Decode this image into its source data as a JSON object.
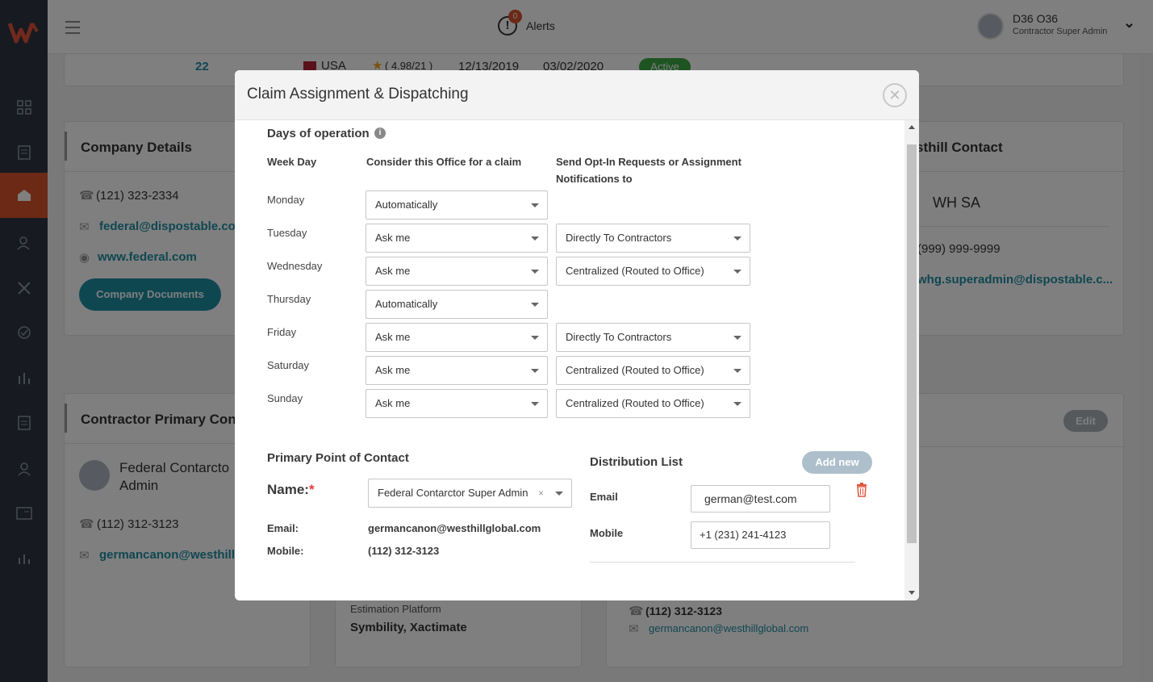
{
  "topbar": {
    "alerts_count": "0",
    "alerts_label": "Alerts",
    "user_name": "D36 O36",
    "user_role": "Contractor Super Admin"
  },
  "background": {
    "summary_row": {
      "id": "22",
      "country": "USA",
      "rating": "( 4.98/21 )",
      "date1": "12/13/2019",
      "date2": "03/02/2020",
      "status": "Active"
    },
    "company_details": {
      "title": "Company Details",
      "phone": "(121) 323-2334",
      "email": "federal@dispostable.co",
      "website": "www.federal.com",
      "documents_button": "Company Documents"
    },
    "westhill_contact": {
      "title": "sthill Contact",
      "name": "WH SA",
      "phone": "(999) 999-9999",
      "email": "whg.superadmin@dispostable.c..."
    },
    "contractor_primary": {
      "title": "Contractor Primary Con",
      "name_line1": "Federal Contarcto",
      "name_line2": "Admin",
      "phone": "(112) 312-3123",
      "email": "germancanon@westhill"
    },
    "edit_button": "Edit",
    "estimation": {
      "label": "Estimation Platform",
      "value": "Symbility, Xactimate"
    },
    "bottom_contact": {
      "phone": "(112) 312-3123",
      "email": "germancanon@westhillglobal.com"
    }
  },
  "modal": {
    "title": "Claim Assignment & Dispatching",
    "section_title": "Days of operation",
    "headers": {
      "week_day": "Week Day",
      "consider": "Consider this Office for a claim",
      "send_line1": "Send Opt-In Requests or Assignment",
      "send_line2": "Notifications to"
    },
    "days": [
      {
        "day": "Monday",
        "consider": "Automatically",
        "send": ""
      },
      {
        "day": "Tuesday",
        "consider": "Ask me",
        "send": "Directly To Contractors"
      },
      {
        "day": "Wednesday",
        "consider": "Ask me",
        "send": "Centralized (Routed to Office)"
      },
      {
        "day": "Thursday",
        "consider": "Automatically",
        "send": ""
      },
      {
        "day": "Friday",
        "consider": "Ask me",
        "send": "Directly To Contractors"
      },
      {
        "day": "Saturday",
        "consider": "Ask me",
        "send": "Centralized (Routed to Office)"
      },
      {
        "day": "Sunday",
        "consider": "Ask me",
        "send": "Centralized (Routed to Office)"
      }
    ],
    "primary_contact": {
      "title": "Primary Point of Contact",
      "name_label": "Name:",
      "name_value": "Federal Contarctor Super Admin",
      "email_label": "Email:",
      "email_value": "germancanon@westhillglobal.com",
      "mobile_label": "Mobile:",
      "mobile_value": "(112) 312-3123"
    },
    "distribution": {
      "title": "Distribution List",
      "add_button": "Add new",
      "email_label": "Email",
      "email_value": "german@test.com",
      "mobile_label": "Mobile",
      "mobile_value": "+1 (231) 241-4123"
    }
  },
  "colors": {
    "sidebar": "#2f3542",
    "accent": "#d9532a",
    "link": "#1f8ea3",
    "active_badge": "#3aa845"
  }
}
